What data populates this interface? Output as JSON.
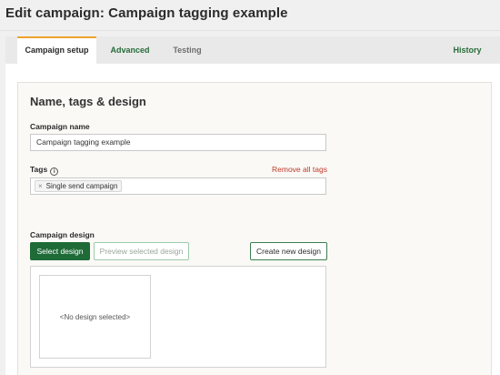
{
  "page": {
    "title": "Edit campaign: Campaign tagging example"
  },
  "tabs": {
    "setup": "Campaign setup",
    "advanced": "Advanced",
    "testing": "Testing",
    "history": "History"
  },
  "section": {
    "title": "Name, tags & design"
  },
  "campaign_name": {
    "label": "Campaign name",
    "value": "Campaign tagging example"
  },
  "tags": {
    "label": "Tags",
    "info_icon": "info-icon",
    "remove_all_label": "Remove all tags",
    "items": [
      {
        "remove_icon": "×",
        "label": "Single send campaign"
      }
    ]
  },
  "design": {
    "label": "Campaign design",
    "select_button": "Select design",
    "preview_button": "Preview selected design",
    "create_button": "Create new design",
    "empty_text": "<No design selected>"
  },
  "colors": {
    "accent_tab": "#f0a32c",
    "primary_green": "#1f6b38",
    "danger_link": "#c0392b"
  }
}
